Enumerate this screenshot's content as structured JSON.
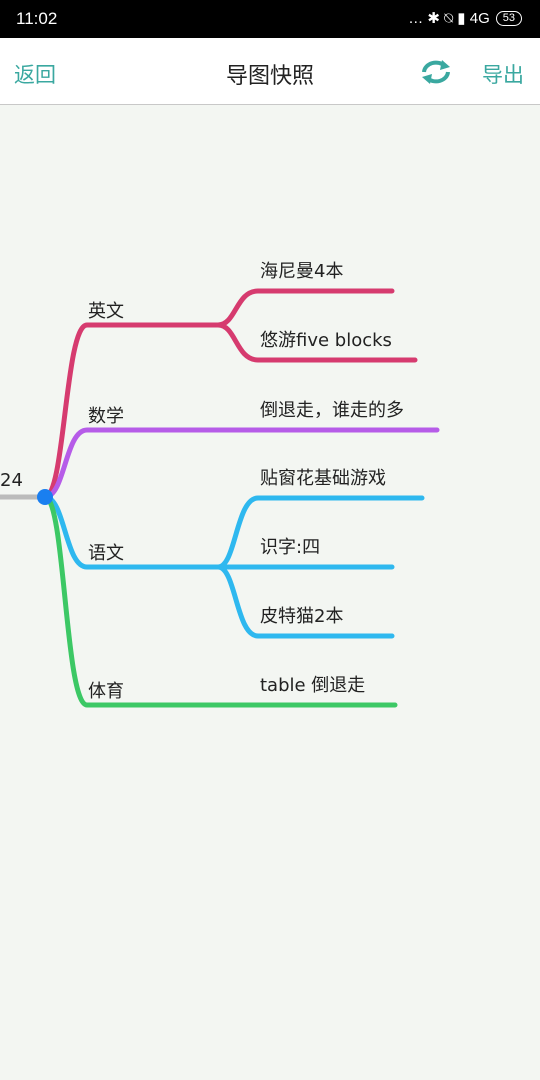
{
  "status": {
    "time": "11:02",
    "icons": "… ✱ ⍉ ▮ 4G",
    "battery": "53"
  },
  "appbar": {
    "back_label": "返回",
    "title": "导图快照",
    "export_label": "导出",
    "refresh_icon": "refresh-icon"
  },
  "mindmap": {
    "root_partial_label": "24",
    "branches": [
      {
        "label": "英文",
        "color": "#d63b6f",
        "children": [
          "海尼曼4本",
          "悠游five blocks"
        ]
      },
      {
        "label": "数学",
        "color": "#b65ce8",
        "children": [
          "倒退走，谁走的多"
        ]
      },
      {
        "label": "语文",
        "color": "#2eb8ef",
        "children": [
          "贴窗花基础游戏",
          "识字:四",
          "皮特猫2本"
        ]
      },
      {
        "label": "体育",
        "color": "#3cc865",
        "children": [
          "table  倒退走"
        ]
      }
    ],
    "root_color": "#1a7ff0",
    "root_line_color": "#bbbbbb"
  }
}
